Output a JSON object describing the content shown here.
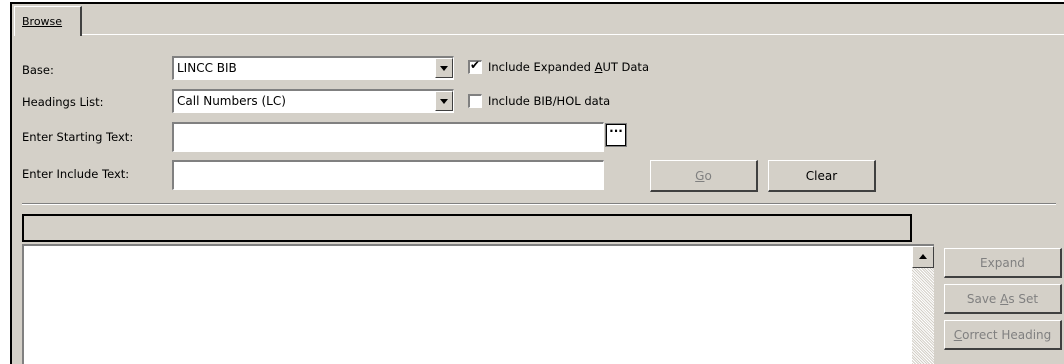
{
  "tabs": [
    {
      "label": "Browse"
    }
  ],
  "form": {
    "base_label": "Base:",
    "base_value": "LINCC BIB",
    "headings_label": "Headings List:",
    "headings_value": "Call Numbers (LC)",
    "starting_label": "Enter Starting Text:",
    "starting_value": "",
    "include_label": "Enter Include Text:",
    "include_value": "",
    "checkbox_expanded": {
      "pre": "Include Expanded ",
      "accel": "A",
      "post": "UT Data",
      "checked": true
    },
    "checkbox_bibhol": {
      "label": "Include BIB/HOL data",
      "checked": false
    },
    "ellipsis": "···"
  },
  "buttons": {
    "go": {
      "accel": "G",
      "rest": "o",
      "enabled": false
    },
    "clear": {
      "label": "Clear",
      "enabled": true
    }
  },
  "side_buttons": {
    "expand": {
      "label": "Expand",
      "enabled": false
    },
    "save_as_set": {
      "pre": "Save ",
      "accel": "A",
      "post": "s Set",
      "enabled": false
    },
    "correct_heading": {
      "accel": "C",
      "post": "orrect Heading",
      "enabled": false
    }
  },
  "colors": {
    "face": "#d4d0c8",
    "disabled_text": "#808080"
  }
}
